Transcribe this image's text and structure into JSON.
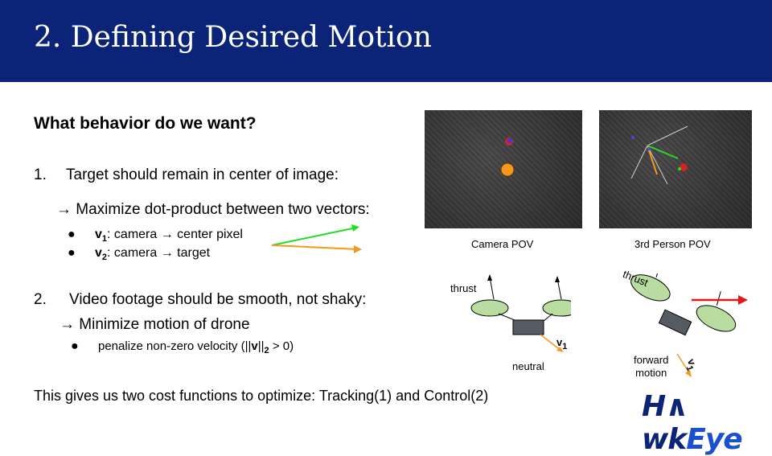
{
  "title": "2. Defining Desired Motion",
  "heading": "What behavior do we want?",
  "items": [
    {
      "number": "1.",
      "text": "Target should remain in center of image:"
    },
    {
      "number": "2.",
      "text": "Video footage should be smooth, not shaky:"
    }
  ],
  "item1_arrow_text": "→ Maximize dot-product between two vectors:",
  "item1_bullets": [
    {
      "bullet": "●",
      "var": "v",
      "sub": "1",
      "text": ": camera → center pixel"
    },
    {
      "bullet": "●",
      "var": "v",
      "sub": "2",
      "text": ": camera → target"
    }
  ],
  "item2_arrow_text": "→ Minimize motion of drone",
  "item2_bullet": {
    "bullet": "●",
    "text_pre": "penalize non-zero velocity (||",
    "var": "v",
    "text_mid": "||",
    "sub": "2",
    "text_post": " > 0)"
  },
  "footer_text": "This gives us two cost functions to optimize: Tracking(1) and Control(2)",
  "captions": {
    "camera_pov": "Camera POV",
    "third_person_pov": "3rd Person POV"
  },
  "diagram_neutral": {
    "thrust": "thrust",
    "v": "v",
    "v_sub": "1",
    "label": "neutral"
  },
  "diagram_forward": {
    "thrust": "thrust",
    "v": "v",
    "v_sub": "1",
    "label_line1": "forward",
    "label_line2": "motion"
  },
  "logo": {
    "part1": "H",
    "part2": "wk",
    "part3": "Eye"
  },
  "colors": {
    "title_bar": "#0c2478",
    "vector1": "#22dd22",
    "vector2": "#f39a1e",
    "motion_arrow": "#e01818",
    "rotor": "#b9dca0"
  }
}
